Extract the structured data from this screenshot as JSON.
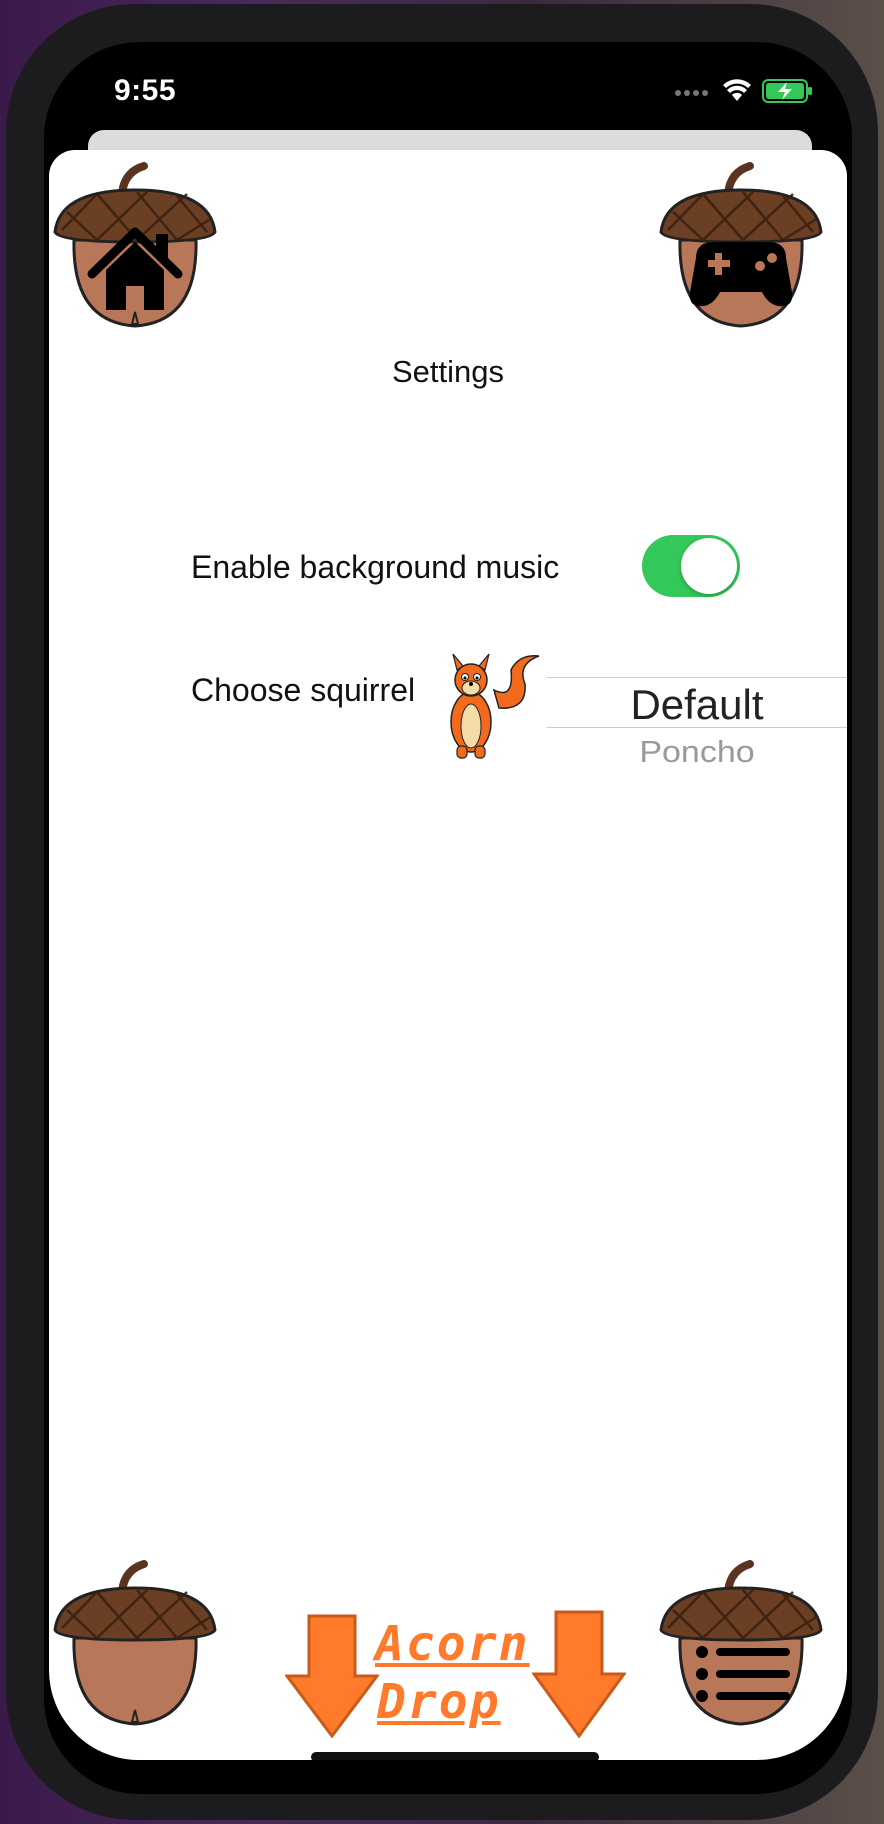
{
  "status_bar": {
    "time": "9:55"
  },
  "nav": {
    "home_icon": "home-icon",
    "game_icon": "gamepad-icon",
    "list_icon": "list-icon"
  },
  "page": {
    "title": "Settings"
  },
  "settings": {
    "music_label": "Enable background music",
    "music_enabled": true,
    "squirrel_label": "Choose squirrel",
    "picker_selected": "Default",
    "picker_next": "Poncho"
  },
  "logo": {
    "line1": "Acorn",
    "line2": "Drop"
  },
  "colors": {
    "toggle_on": "#34c759",
    "acorn_cap": "#6b3f24",
    "acorn_body": "#b9775a",
    "accent_orange": "#ff7a2a"
  }
}
